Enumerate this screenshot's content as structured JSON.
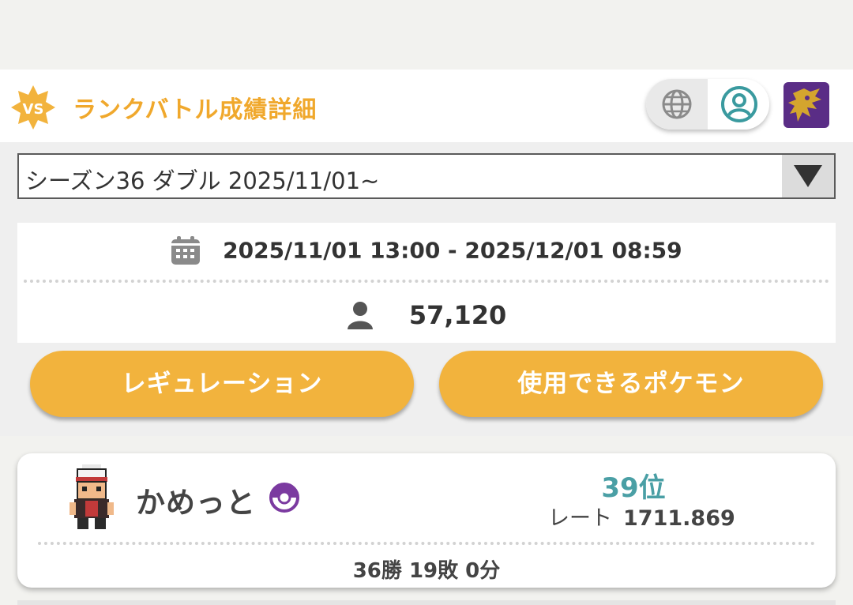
{
  "header": {
    "badge_text": "VS",
    "title": "ランクバトル成績詳細",
    "language_icon": "globe-icon",
    "account_icon": "user-circle-icon",
    "avatar_icon": "legendary-dragon-icon"
  },
  "season_select": {
    "selected": "シーズン36 ダブル 2025/11/01~"
  },
  "season_info": {
    "period": "2025/11/01 13:00 - 2025/12/01 08:59",
    "players": "57,120"
  },
  "buttons": {
    "regulation": "レギュレーション",
    "usable_pokemon": "使用できるポケモン"
  },
  "player": {
    "name": "かめっと",
    "rank": "39位",
    "rate_label": "レート",
    "rate_value": "1711.869",
    "record": "36勝 19敗 0分"
  },
  "colors": {
    "accent": "#f0a82c",
    "button": "#f2b33d",
    "rank": "#4a9fa5",
    "ball": "#7b3aa0",
    "avatar_bg": "#5a2d86"
  }
}
